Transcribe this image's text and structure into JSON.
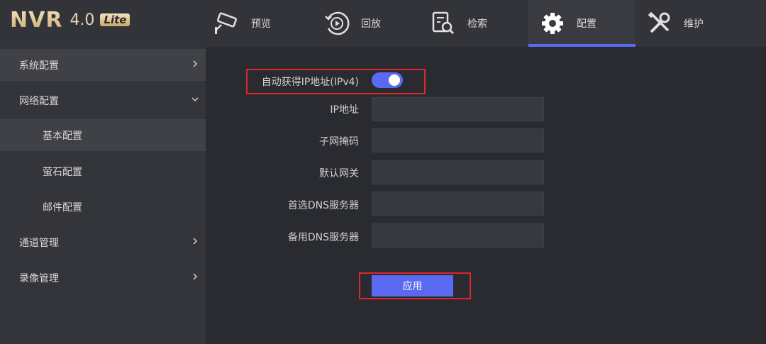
{
  "brand": {
    "name": "NVR",
    "version": "4.0",
    "edition": "Lite"
  },
  "nav": {
    "tabs": [
      {
        "label": "预览",
        "icon": "camera-icon"
      },
      {
        "label": "回放",
        "icon": "playback-icon"
      },
      {
        "label": "检索",
        "icon": "search-document-icon"
      },
      {
        "label": "配置",
        "icon": "gear-icon",
        "active": true
      },
      {
        "label": "维护",
        "icon": "tools-icon"
      }
    ]
  },
  "sidebar": {
    "items": [
      {
        "label": "系统配置",
        "chevron": "right"
      },
      {
        "label": "网络配置",
        "chevron": "down"
      },
      {
        "label": "基本配置",
        "selected": true
      },
      {
        "label": "萤石配置"
      },
      {
        "label": "邮件配置"
      },
      {
        "label": "通道管理",
        "chevron": "right"
      },
      {
        "label": "录像管理",
        "chevron": "right"
      }
    ]
  },
  "form": {
    "dhcp_label": "自动获得IP地址(IPv4)",
    "dhcp_enabled": true,
    "ip_label": "IP地址",
    "ip_value": "",
    "subnet_label": "子网掩码",
    "subnet_value": "",
    "gateway_label": "默认网关",
    "gateway_value": "",
    "dns1_label": "首选DNS服务器",
    "dns1_value": "",
    "dns2_label": "备用DNS服务器",
    "dns2_value": "",
    "apply_label": "应用"
  },
  "colors": {
    "accent": "#5a6af0",
    "highlight_box": "#e0252b",
    "logo_gold": "#e8d6ad"
  }
}
